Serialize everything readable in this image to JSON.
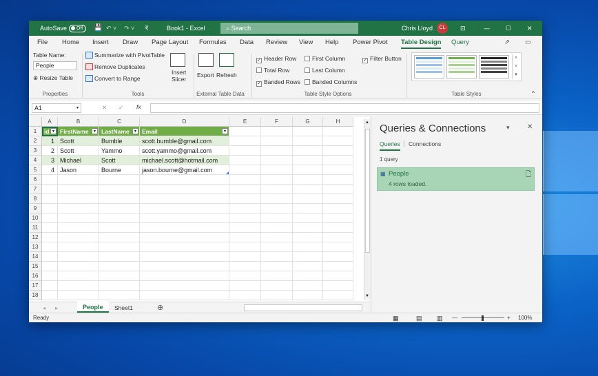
{
  "titlebar": {
    "autosave_label": "AutoSave",
    "autosave_state": "Off",
    "qat_save": "💾",
    "qat_undo": "↶ ˅",
    "qat_redo": "↷ ˅",
    "qat_more": "₹",
    "doc_title": "Book1 - Excel",
    "search_placeholder": "Search",
    "user_name": "Chris Lloyd",
    "user_initials": "CL",
    "ribbon_display": "⊡",
    "minimize": "—",
    "maximize": "☐",
    "close": "✕"
  },
  "tabs": [
    "File",
    "Home",
    "Insert",
    "Draw",
    "Page Layout",
    "Formulas",
    "Data",
    "Review",
    "View",
    "Help",
    "Power Pivot",
    "Table Design",
    "Query"
  ],
  "tab_icons": {
    "share": "⇗",
    "comments": "▭"
  },
  "ribbon": {
    "properties": {
      "table_name_label": "Table Name:",
      "table_name_value": "People",
      "resize": "Resize Table",
      "group": "Properties"
    },
    "tools": {
      "summarize": "Summarize with PivotTable",
      "remove_dup": "Remove Duplicates",
      "convert": "Convert to Range",
      "insert_slicer_1": "Insert",
      "insert_slicer_2": "Slicer",
      "group": "Tools"
    },
    "external": {
      "export": "Export",
      "refresh": "Refresh",
      "group": "External Table Data"
    },
    "style_options": {
      "header_row": "Header Row",
      "total_row": "Total Row",
      "banded_rows": "Banded Rows",
      "first_column": "First Column",
      "last_column": "Last Column",
      "banded_columns": "Banded Columns",
      "filter_button": "Filter Button",
      "group": "Table Style Options"
    },
    "table_styles": {
      "group": "Table Styles"
    },
    "collapse": "^"
  },
  "formula_bar": {
    "name_box": "A1",
    "cancel": "✕",
    "enter": "✓",
    "fx": "fx",
    "value": ""
  },
  "sheet": {
    "columns": [
      "A",
      "B",
      "C",
      "D",
      "E",
      "F",
      "G",
      "H"
    ],
    "rows": [
      "1",
      "2",
      "3",
      "4",
      "5",
      "6",
      "7",
      "8",
      "9",
      "10",
      "11",
      "12",
      "13",
      "14",
      "15",
      "16",
      "17",
      "18"
    ],
    "headers": [
      "id",
      "FirstName",
      "LastName",
      "Email"
    ],
    "data": [
      [
        "1",
        "Scott",
        "Bumble",
        "scott.bumble@gmail.com"
      ],
      [
        "2",
        "Scott",
        "Yammo",
        "scott.yammo@gmail.com"
      ],
      [
        "3",
        "Michael",
        "Scott",
        "michael.scott@hotmail.com"
      ],
      [
        "4",
        "Jason",
        "Bourne",
        "jason.bourne@gmail.com"
      ]
    ]
  },
  "sheet_tabs": {
    "active": "People",
    "other": "Sheet1",
    "add": "⊕"
  },
  "status": {
    "ready": "Ready",
    "zoom": "100%"
  },
  "pane": {
    "title": "Queries & Connections",
    "tab_queries": "Queries",
    "tab_connections": "Connections",
    "count": "1 query",
    "query_name": "People",
    "query_status": "4 rows loaded.",
    "options": "▾",
    "close": "✕"
  }
}
